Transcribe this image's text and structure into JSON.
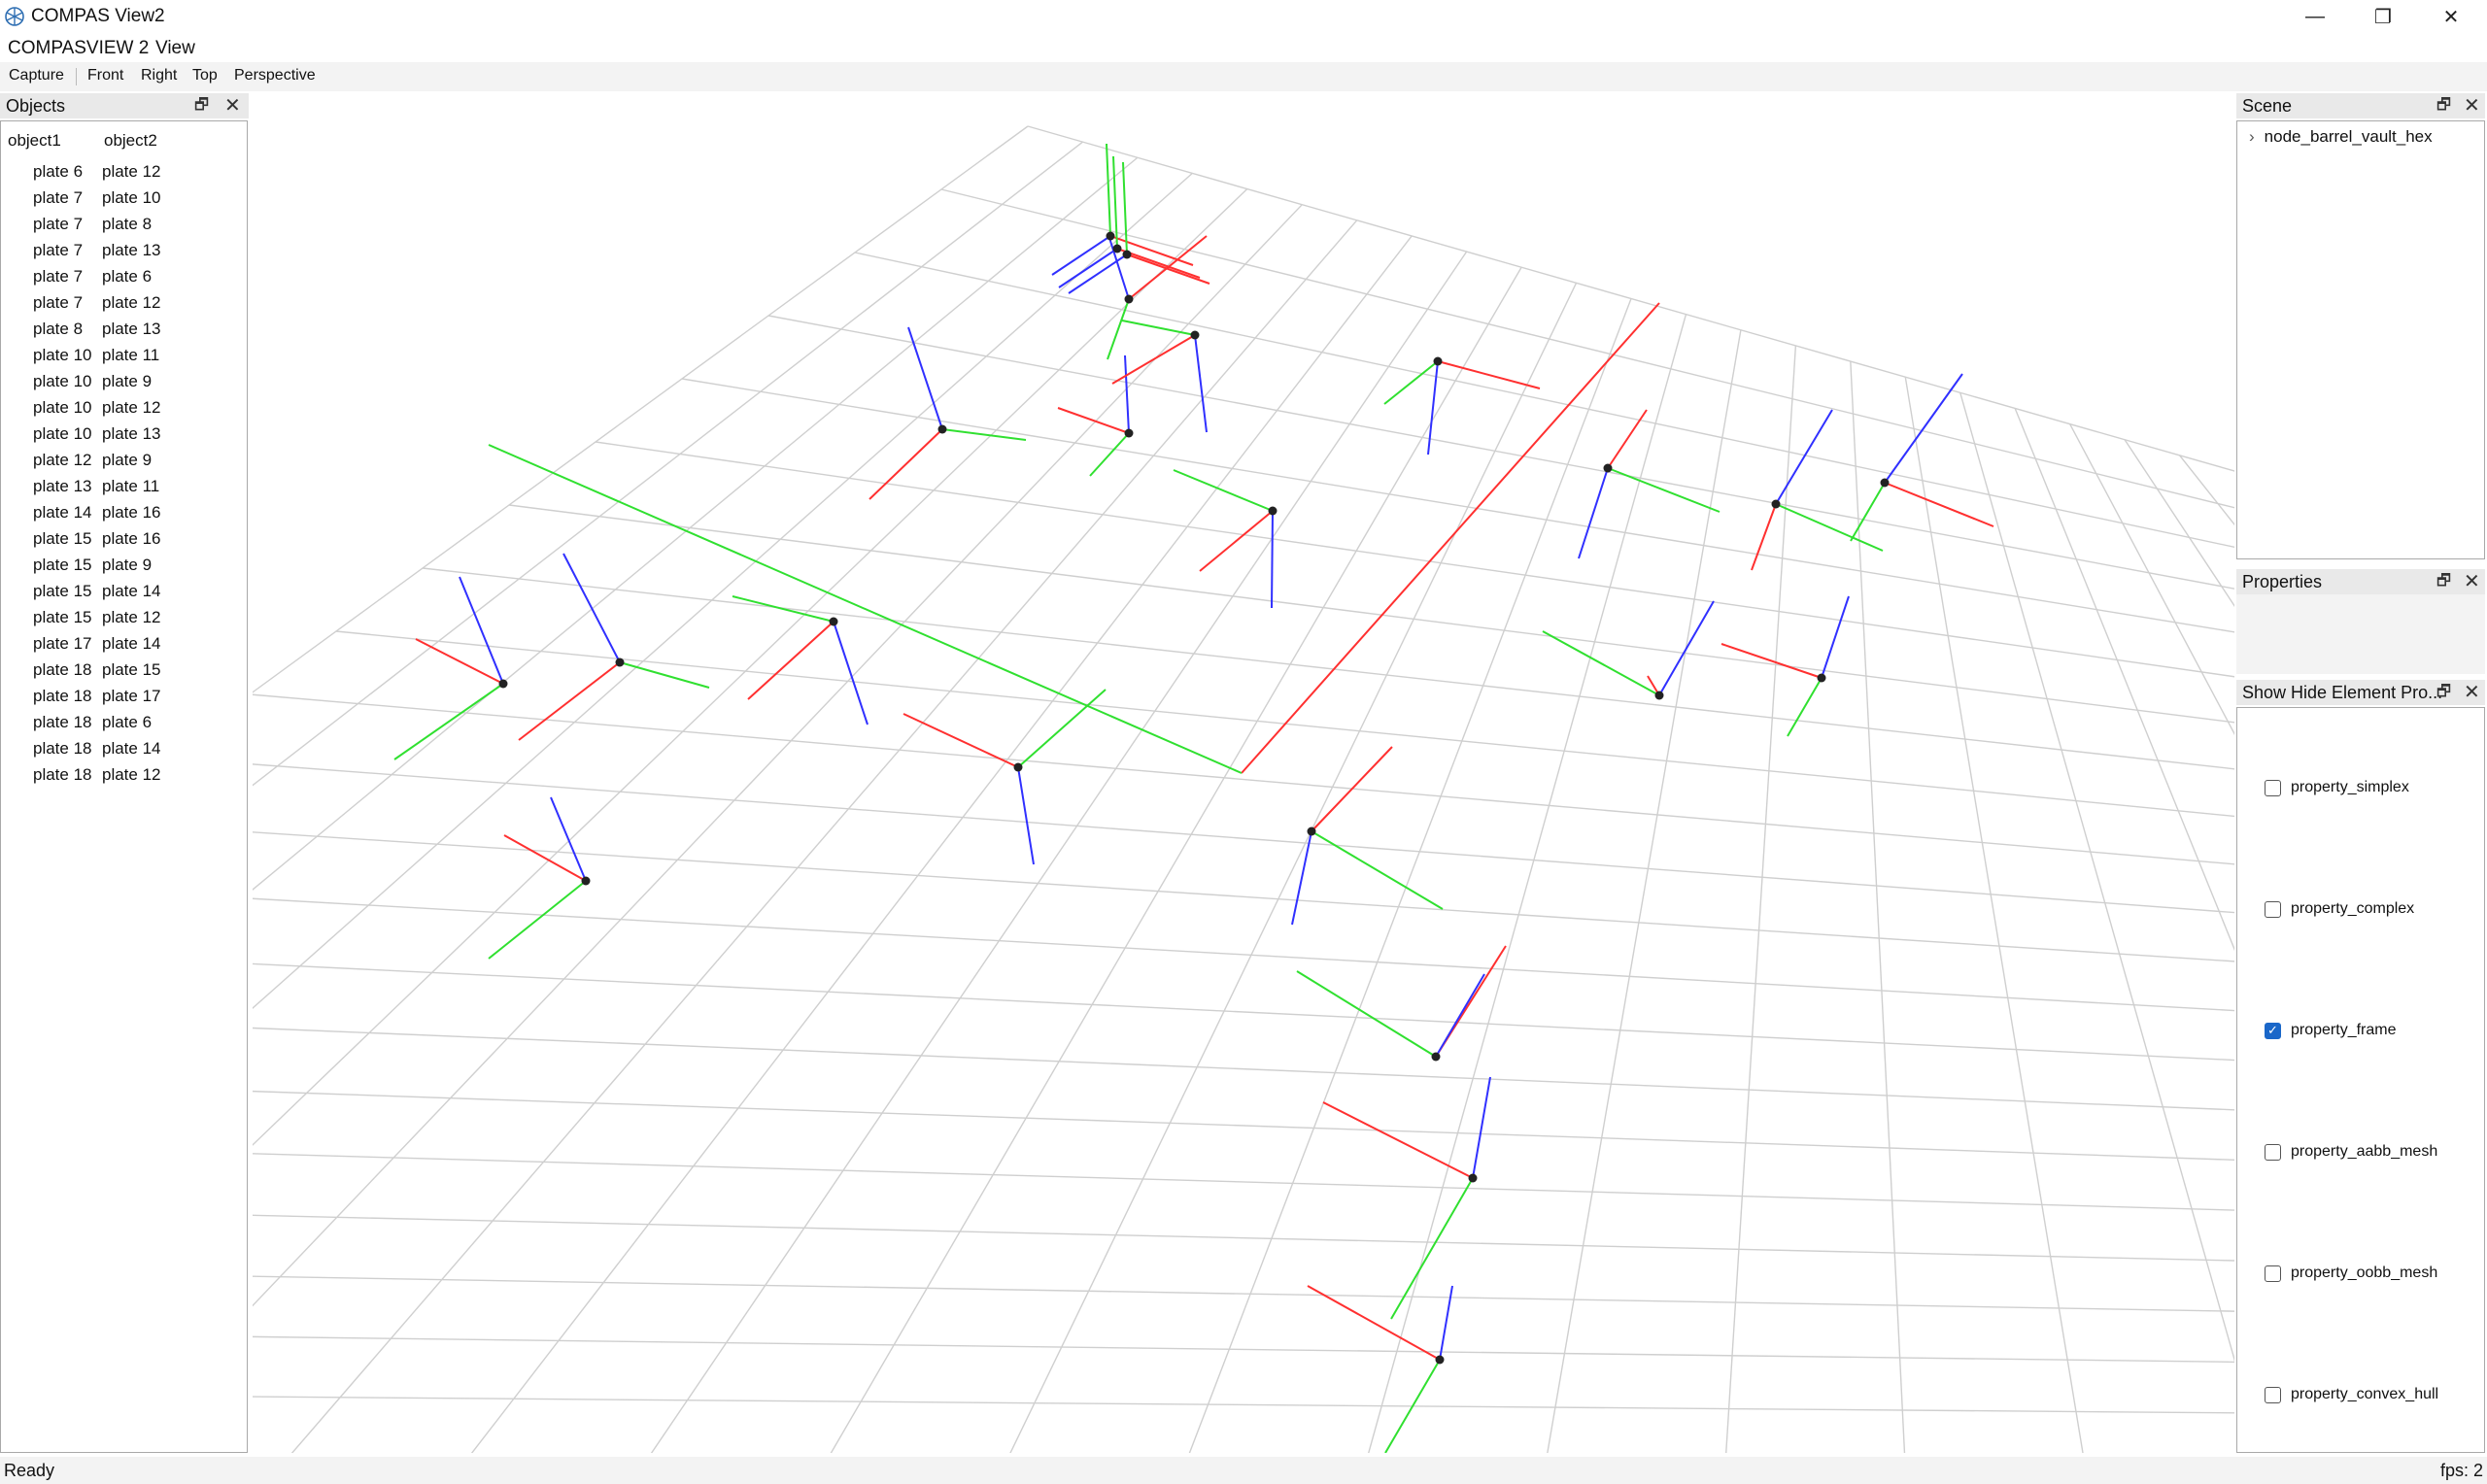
{
  "window": {
    "title": "COMPAS View2",
    "minimize_glyph": "—",
    "restore_glyph": "❐",
    "close_glyph": "✕"
  },
  "menu": [
    "COMPASVIEW 2",
    "View"
  ],
  "toolbar": [
    "Capture",
    "Front",
    "Right",
    "Top",
    "Perspective"
  ],
  "objects_panel": {
    "title": "Objects",
    "columns": [
      "object1",
      "object2"
    ],
    "rows": [
      [
        "plate 6",
        "plate 12"
      ],
      [
        "plate 7",
        "plate 10"
      ],
      [
        "plate 7",
        "plate 8"
      ],
      [
        "plate 7",
        "plate 13"
      ],
      [
        "plate 7",
        "plate 6"
      ],
      [
        "plate 7",
        "plate 12"
      ],
      [
        "plate 8",
        "plate 13"
      ],
      [
        "plate 10",
        "plate 11"
      ],
      [
        "plate 10",
        "plate 9"
      ],
      [
        "plate 10",
        "plate 12"
      ],
      [
        "plate 10",
        "plate 13"
      ],
      [
        "plate 12",
        "plate 9"
      ],
      [
        "plate 13",
        "plate 11"
      ],
      [
        "plate 14",
        "plate 16"
      ],
      [
        "plate 15",
        "plate 16"
      ],
      [
        "plate 15",
        "plate 9"
      ],
      [
        "plate 15",
        "plate 14"
      ],
      [
        "plate 15",
        "plate 12"
      ],
      [
        "plate 17",
        "plate 14"
      ],
      [
        "plate 18",
        "plate 15"
      ],
      [
        "plate 18",
        "plate 17"
      ],
      [
        "plate 18",
        "plate 6"
      ],
      [
        "plate 18",
        "plate 14"
      ],
      [
        "plate 18",
        "plate 12"
      ]
    ]
  },
  "scene_panel": {
    "title": "Scene",
    "items": [
      "node_barrel_vault_hex"
    ]
  },
  "properties_panel": {
    "title": "Properties"
  },
  "show_hide_panel": {
    "title": "Show Hide Element Pro...",
    "options": [
      {
        "label": "property_simplex",
        "checked": false
      },
      {
        "label": "property_complex",
        "checked": false
      },
      {
        "label": "property_frame",
        "checked": true
      },
      {
        "label": "property_aabb_mesh",
        "checked": false
      },
      {
        "label": "property_oobb_mesh",
        "checked": false
      },
      {
        "label": "property_convex_hull",
        "checked": false
      }
    ]
  },
  "status": {
    "left": "Ready",
    "right": "fps: 2"
  },
  "colors": {
    "axis_x": "#ff3030",
    "axis_y": "#30e030",
    "axis_z": "#3030ff",
    "grid": "#cfcfcf",
    "node": "#222222",
    "checkbox": "#1a67c9"
  }
}
